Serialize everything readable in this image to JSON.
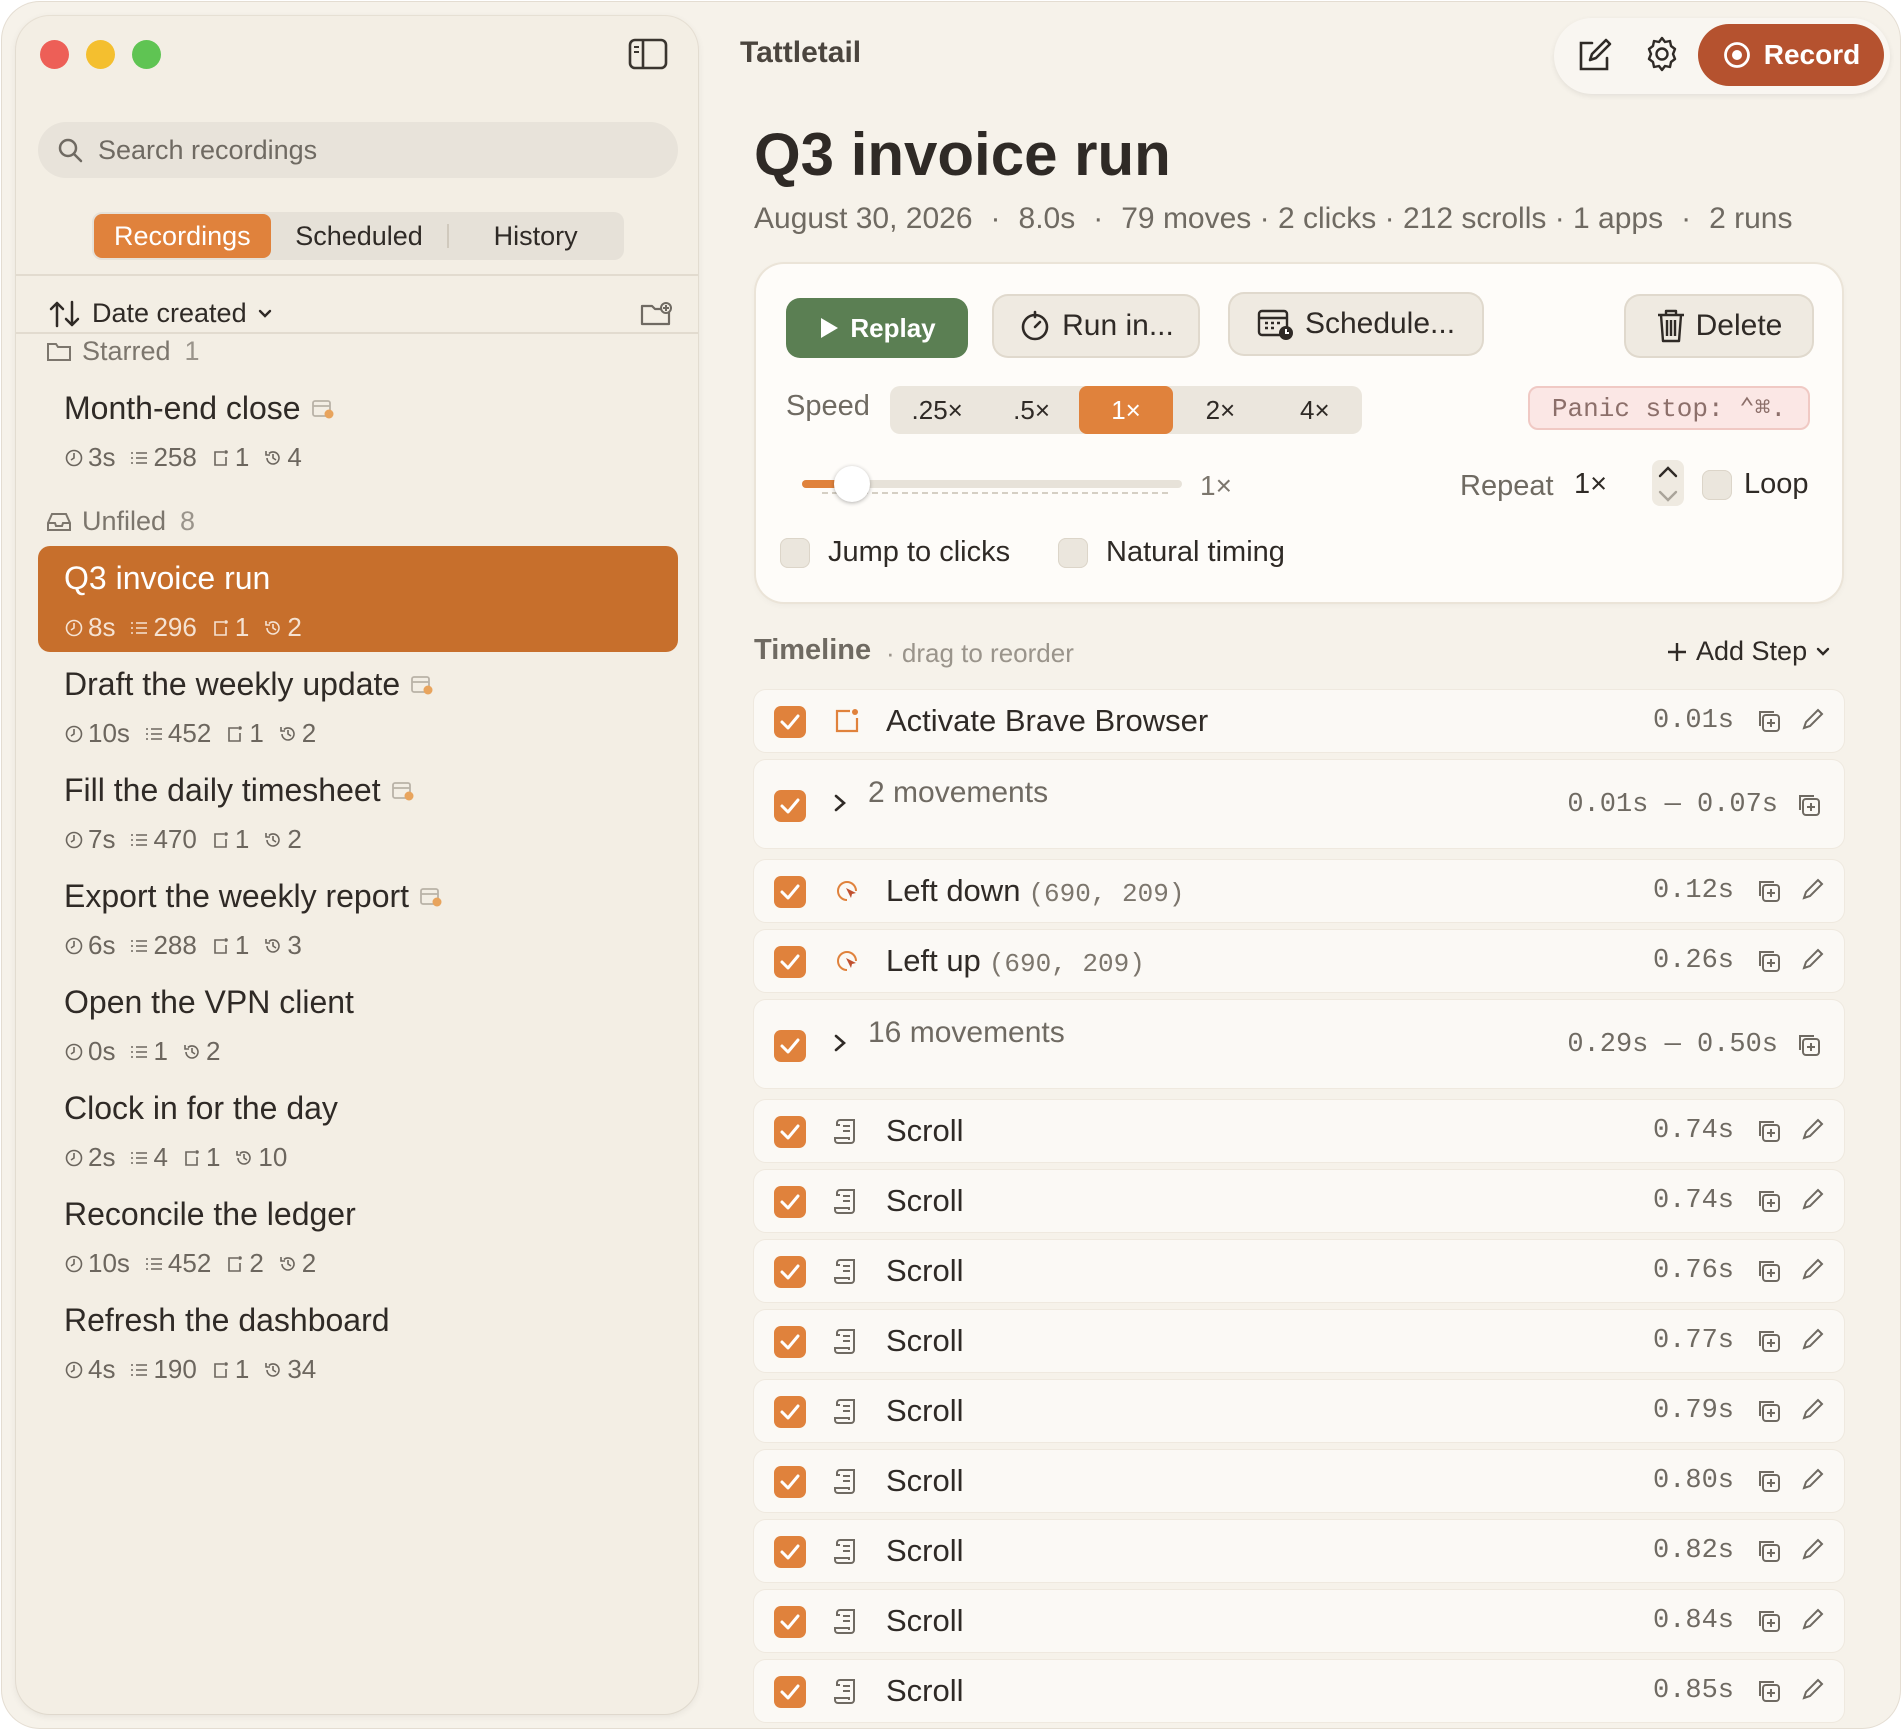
{
  "app": {
    "title": "Tattletail"
  },
  "sidebar": {
    "search_placeholder": "Search recordings",
    "tabs": [
      {
        "label": "Recordings",
        "active": true
      },
      {
        "label": "Scheduled",
        "active": false
      },
      {
        "label": "History",
        "active": false
      }
    ],
    "sort_label": "Date created",
    "groups": {
      "starred": {
        "label": "Starred",
        "count": "1"
      },
      "unfiled": {
        "label": "Unfiled",
        "count": "8"
      }
    },
    "items": [
      {
        "title": "Month-end close",
        "duration": "3s",
        "steps": "258",
        "clicks": "1",
        "runs": "4",
        "scheduled": true
      },
      {
        "title": "Q3 invoice run",
        "duration": "8s",
        "steps": "296",
        "clicks": "1",
        "runs": "2",
        "selected": true
      },
      {
        "title": "Draft the weekly update",
        "duration": "10s",
        "steps": "452",
        "clicks": "1",
        "runs": "2",
        "scheduled": true
      },
      {
        "title": "Fill the daily timesheet",
        "duration": "7s",
        "steps": "470",
        "clicks": "1",
        "runs": "2",
        "scheduled": true
      },
      {
        "title": "Export the weekly report",
        "duration": "6s",
        "steps": "288",
        "clicks": "1",
        "runs": "3",
        "scheduled": true
      },
      {
        "title": "Open the VPN client",
        "duration": "0s",
        "steps": "1",
        "runs": "2"
      },
      {
        "title": "Clock in for the day",
        "duration": "2s",
        "steps": "4",
        "clicks": "1",
        "runs": "10"
      },
      {
        "title": "Reconcile the ledger",
        "duration": "10s",
        "steps": "452",
        "clicks": "2",
        "runs": "2"
      },
      {
        "title": "Refresh the dashboard",
        "duration": "4s",
        "steps": "190",
        "clicks": "1",
        "runs": "34"
      }
    ]
  },
  "toolbar": {
    "record_label": "Record"
  },
  "detail": {
    "title": "Q3 invoice run",
    "date": "August 30, 2026",
    "duration": "8.0s",
    "stats": "79 moves · 2 clicks · 212 scrolls · 1 apps",
    "runs": "2 runs",
    "dot": "·",
    "buttons": {
      "replay": "Replay",
      "run_in": "Run in...",
      "schedule": "Schedule...",
      "delete": "Delete"
    },
    "speed_label": "Speed",
    "speeds": [
      ".25×",
      ".5×",
      "1×",
      "2×",
      "4×"
    ],
    "active_speed": "1×",
    "panic": "Panic stop: ⌃⌘.",
    "slider_value": "1×",
    "repeat_label": "Repeat",
    "repeat_value": "1×",
    "loop_label": "Loop",
    "jump_label": "Jump to clicks",
    "natural_label": "Natural timing"
  },
  "timeline": {
    "title": "Timeline",
    "hint": "· drag to reorder",
    "add_step": "Add Step",
    "rows": [
      {
        "kind": "app",
        "label": "Activate Brave Browser",
        "time": "0.01s"
      },
      {
        "kind": "group",
        "label": "2 movements",
        "time": "0.01s — 0.07s"
      },
      {
        "kind": "click",
        "label": "Left down",
        "coord": "(690, 209)",
        "time": "0.12s"
      },
      {
        "kind": "click",
        "label": "Left up",
        "coord": "(690, 209)",
        "time": "0.26s"
      },
      {
        "kind": "group",
        "label": "16 movements",
        "time": "0.29s — 0.50s"
      },
      {
        "kind": "scroll",
        "label": "Scroll",
        "time": "0.74s"
      },
      {
        "kind": "scroll",
        "label": "Scroll",
        "time": "0.74s"
      },
      {
        "kind": "scroll",
        "label": "Scroll",
        "time": "0.76s"
      },
      {
        "kind": "scroll",
        "label": "Scroll",
        "time": "0.77s"
      },
      {
        "kind": "scroll",
        "label": "Scroll",
        "time": "0.79s"
      },
      {
        "kind": "scroll",
        "label": "Scroll",
        "time": "0.80s"
      },
      {
        "kind": "scroll",
        "label": "Scroll",
        "time": "0.82s"
      },
      {
        "kind": "scroll",
        "label": "Scroll",
        "time": "0.84s"
      },
      {
        "kind": "scroll",
        "label": "Scroll",
        "time": "0.85s"
      }
    ]
  },
  "colors": {
    "accent": "#e0823c",
    "selected": "#c76f2c",
    "replay": "#5b7f53",
    "record": "#b5522f"
  }
}
